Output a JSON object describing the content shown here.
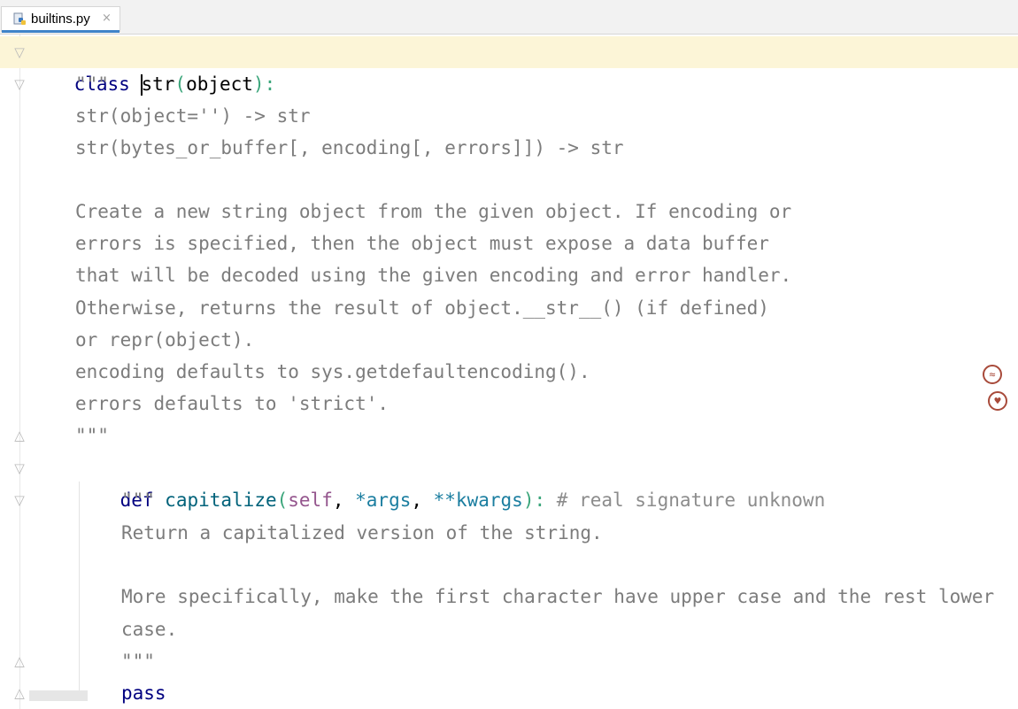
{
  "tab": {
    "filename": "builtins.py",
    "close_glyph": "×",
    "icon": "python-file-icon"
  },
  "code": {
    "line1": {
      "kw": "class",
      "name_first": "s",
      "name_rest": "tr",
      "open": "(",
      "base": "object",
      "close": ")",
      "colon": ":"
    },
    "doc_open": "\"\"\"",
    "doc_sig1": "str(object='') -> str",
    "doc_sig2": "str(bytes_or_buffer[, encoding[, errors]]) -> str",
    "doc_p1": "Create a new string object from the given object. If encoding or",
    "doc_p2": "errors is specified, then the object must expose a data buffer",
    "doc_p3": "that will be decoded using the given encoding and error handler.",
    "doc_p4": "Otherwise, returns the result of object.__str__() (if defined)",
    "doc_p5": "or repr(object).",
    "doc_p6": "encoding defaults to sys.getdefaultencoding().",
    "doc_p7": "errors defaults to 'strict'.",
    "doc_close": "\"\"\"",
    "def_line": {
      "kw": "def",
      "name": "capitalize",
      "open": "(",
      "self": "self",
      "comma1": ", ",
      "args": "*args",
      "comma2": ", ",
      "kwargs": "**kwargs",
      "close": ")",
      "colon": ":",
      "comment": "# real signature unknown"
    },
    "m_doc_open": "\"\"\"",
    "m_doc1": "Return a capitalized version of the string.",
    "m_doc2": "More specifically, make the first character have upper case and the rest lower",
    "m_doc3": "case.",
    "m_doc_close": "\"\"\"",
    "pass_kw": "pass"
  },
  "colors": {
    "keyword": "#000080",
    "docstring": "#7c7c7c",
    "current_line": "#fcf5d7",
    "tab_accent": "#4083c9"
  },
  "side_icons": [
    "plugin-icon-1",
    "plugin-icon-2"
  ]
}
